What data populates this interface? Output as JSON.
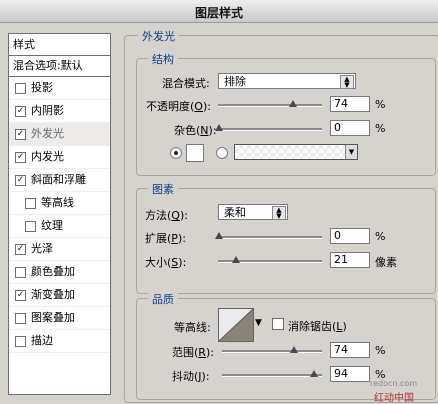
{
  "window": {
    "title": "图层样式"
  },
  "styles_panel": {
    "header": "样式",
    "blend_options": "混合选项:默认",
    "items": [
      {
        "label": "投影",
        "checked": false,
        "selected": false,
        "sub": false
      },
      {
        "label": "内阴影",
        "checked": true,
        "selected": false,
        "sub": false
      },
      {
        "label": "外发光",
        "checked": true,
        "selected": true,
        "sub": false
      },
      {
        "label": "内发光",
        "checked": true,
        "selected": false,
        "sub": false
      },
      {
        "label": "斜面和浮雕",
        "checked": true,
        "selected": false,
        "sub": false
      },
      {
        "label": "等高线",
        "checked": false,
        "selected": false,
        "sub": true
      },
      {
        "label": "纹理",
        "checked": false,
        "selected": false,
        "sub": true
      },
      {
        "label": "光泽",
        "checked": true,
        "selected": false,
        "sub": false
      },
      {
        "label": "颜色叠加",
        "checked": false,
        "selected": false,
        "sub": false
      },
      {
        "label": "渐变叠加",
        "checked": true,
        "selected": false,
        "sub": false
      },
      {
        "label": "图案叠加",
        "checked": false,
        "selected": false,
        "sub": false
      },
      {
        "label": "描边",
        "checked": false,
        "selected": false,
        "sub": false
      }
    ]
  },
  "outer_glow": {
    "section_title": "外发光",
    "structure": {
      "title": "结构",
      "blend_mode_label": "混合模式:",
      "blend_mode_value": "排除",
      "opacity_label": "不透明度(",
      "opacity_key": "O",
      "opacity_close": "):",
      "opacity_value": "74",
      "noise_label": "杂色(",
      "noise_key": "N",
      "noise_close": "):",
      "noise_value": "0",
      "percent": "%"
    },
    "elements": {
      "title": "图素",
      "method_label": "方法(",
      "method_key": "Q",
      "method_close": "):",
      "method_value": "柔和",
      "spread_label": "扩展(",
      "spread_key": "P",
      "spread_close": "):",
      "spread_value": "0",
      "size_label": "大小(",
      "size_key": "S",
      "size_close": "):",
      "size_value": "21",
      "size_unit": "像素",
      "percent": "%"
    },
    "quality": {
      "title": "品质",
      "contour_label": "等高线:",
      "antialias_label": "消除锯齿(",
      "antialias_key": "L",
      "antialias_close": ")",
      "range_label": "范围(",
      "range_key": "R",
      "range_close": "):",
      "range_value": "74",
      "jitter_label": "抖动(",
      "jitter_key": "J",
      "jitter_close": "):",
      "jitter_value": "94",
      "percent": "%"
    }
  },
  "watermark": {
    "text": "红动中国",
    "url_text": "redocn.com"
  },
  "icons": {
    "dropdown": "updown-arrows-icon",
    "check": "checkmark-icon"
  }
}
